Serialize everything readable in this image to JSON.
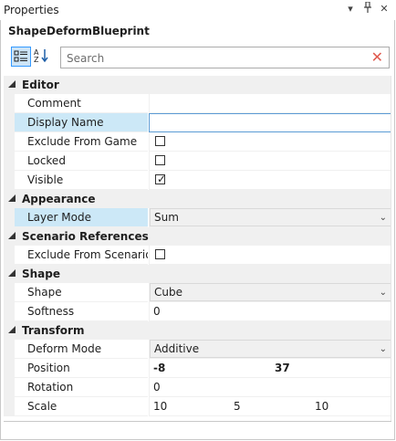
{
  "window": {
    "title": "Properties",
    "dropdown_glyph": "▾",
    "pin_glyph": "📌",
    "close_glyph": "✕"
  },
  "object": {
    "name": "ShapeDeformBlueprint"
  },
  "toolbar": {
    "search_placeholder": "Search",
    "clear_glyph": "✕"
  },
  "categories": {
    "editor": {
      "label": "Editor",
      "rows": {
        "comment": {
          "label": "Comment",
          "value": ""
        },
        "display_name": {
          "label": "Display Name",
          "value": ""
        },
        "exclude_from_game": {
          "label": "Exclude From Game",
          "checked": false
        },
        "locked": {
          "label": "Locked",
          "checked": false
        },
        "visible": {
          "label": "Visible",
          "checked": true,
          "check_glyph": "✓"
        }
      }
    },
    "appearance": {
      "label": "Appearance",
      "rows": {
        "layer_mode": {
          "label": "Layer Mode",
          "value": "Sum"
        }
      }
    },
    "scenario_references": {
      "label": "Scenario References",
      "rows": {
        "exclude_from_scenario": {
          "label": "Exclude From Scenario...",
          "checked": false
        }
      }
    },
    "shape": {
      "label": "Shape",
      "rows": {
        "shape": {
          "label": "Shape",
          "value": "Cube"
        },
        "softness": {
          "label": "Softness",
          "value": "0"
        }
      }
    },
    "transform": {
      "label": "Transform",
      "rows": {
        "deform_mode": {
          "label": "Deform Mode",
          "value": "Additive"
        },
        "position": {
          "label": "Position",
          "x": "-8",
          "y": "37"
        },
        "rotation": {
          "label": "Rotation",
          "value": "0"
        },
        "scale": {
          "label": "Scale",
          "x": "10",
          "y": "5",
          "z": "10"
        }
      }
    }
  },
  "combo_glyph": "⌄"
}
